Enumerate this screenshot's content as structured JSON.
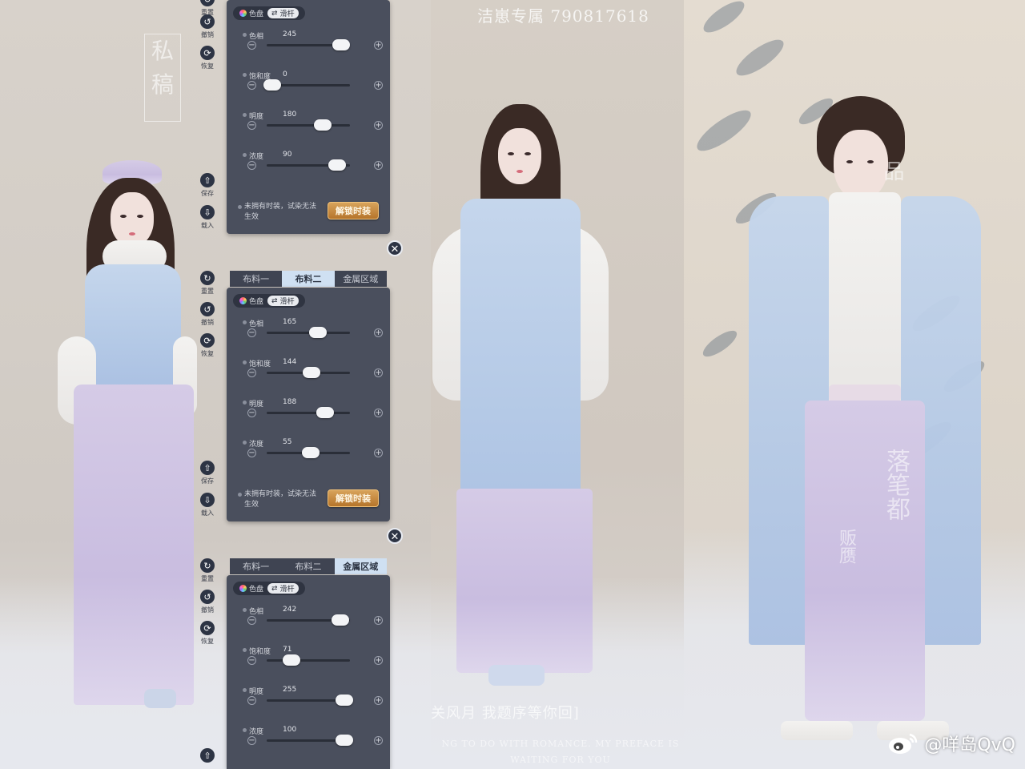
{
  "watermark_top": "洁崽专属  790817618",
  "seal_left": [
    "私",
    "稿"
  ],
  "seal_right_vertical": [
    "落",
    "笔",
    "都"
  ],
  "seal_right_small": [
    "贩",
    "赝",
    "品"
  ],
  "caption_bottom": "关风月 我题序等你回]",
  "caption_bottom_en": [
    "NG TO DO WITH ROMANCE. MY PREFACE IS",
    "WAITING FOR YOU"
  ],
  "weibo_handle": "@咩岛QvQ",
  "colors": {
    "panel_bg": "#4a4f5d",
    "tab_active_bg": "#cfe0f2",
    "unlock_btn": "#c58a40",
    "icon_bg": "#2d3444"
  },
  "side_tools": {
    "reset": "重置",
    "undo": "撤销",
    "restore": "恢复",
    "save": "保存",
    "load": "载入"
  },
  "panels": [
    {
      "tabs": [],
      "mode_options": [
        "色盘",
        "滑杆"
      ],
      "active_mode": 1,
      "sliders": [
        {
          "label": "色相",
          "value": "245",
          "fraction": 0.89
        },
        {
          "label": "饱和度",
          "value": "0",
          "fraction": 0.07
        },
        {
          "label": "明度",
          "value": "180",
          "fraction": 0.67
        },
        {
          "label": "浓度",
          "value": "90",
          "fraction": 0.85
        }
      ],
      "note": "未拥有时装，试染无法生效",
      "unlock_label": "解锁时装"
    },
    {
      "tabs": [
        "布料一",
        "布料二",
        "金属区域"
      ],
      "active_tab": 1,
      "mode_options": [
        "色盘",
        "滑杆"
      ],
      "active_mode": 1,
      "sliders": [
        {
          "label": "色相",
          "value": "165",
          "fraction": 0.62
        },
        {
          "label": "饱和度",
          "value": "144",
          "fraction": 0.54
        },
        {
          "label": "明度",
          "value": "188",
          "fraction": 0.7
        },
        {
          "label": "浓度",
          "value": "55",
          "fraction": 0.53
        }
      ],
      "note": "未拥有时装，试染无法生效",
      "unlock_label": "解锁时装"
    },
    {
      "tabs": [
        "布料一",
        "布料二",
        "金属区域"
      ],
      "active_tab": 2,
      "mode_options": [
        "色盘",
        "滑杆"
      ],
      "active_mode": 1,
      "sliders": [
        {
          "label": "色相",
          "value": "242",
          "fraction": 0.88
        },
        {
          "label": "饱和度",
          "value": "71",
          "fraction": 0.3
        },
        {
          "label": "明度",
          "value": "255",
          "fraction": 0.93
        },
        {
          "label": "浓度",
          "value": "100",
          "fraction": 0.93
        }
      ]
    }
  ]
}
